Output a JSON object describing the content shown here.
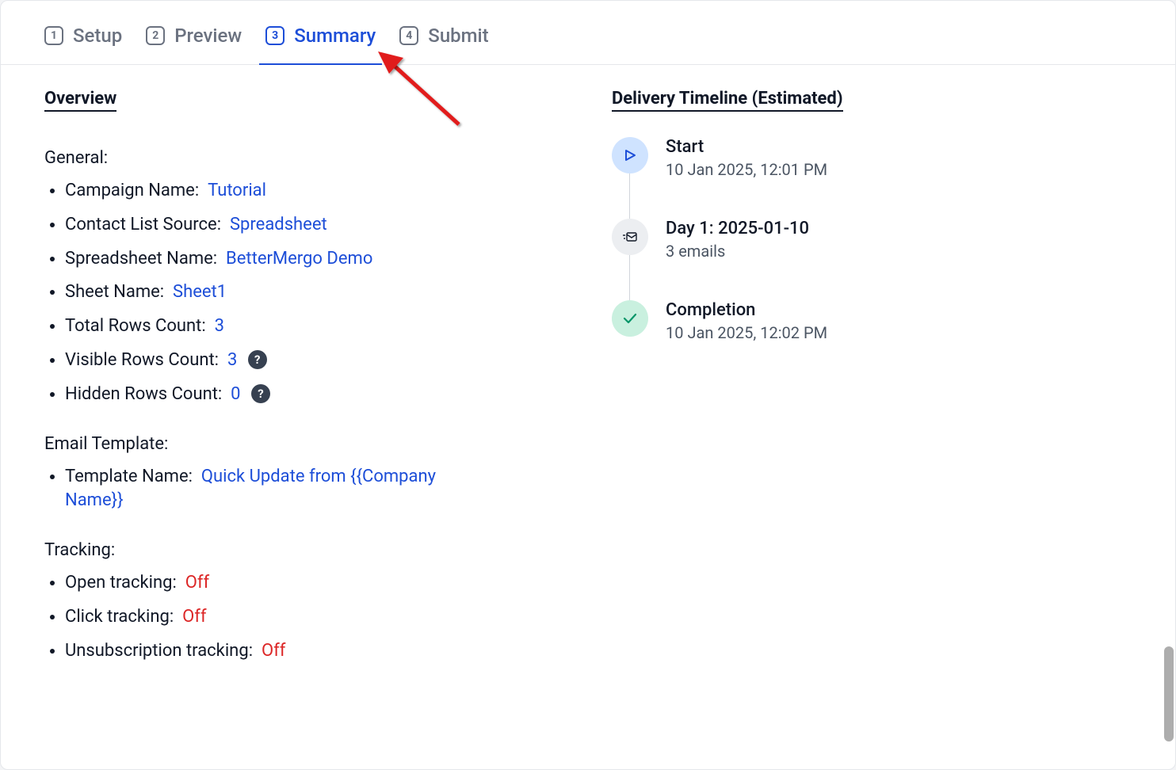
{
  "tabs": {
    "setup": {
      "num": "1",
      "label": "Setup"
    },
    "preview": {
      "num": "2",
      "label": "Preview"
    },
    "summary": {
      "num": "3",
      "label": "Summary"
    },
    "submit": {
      "num": "4",
      "label": "Submit"
    }
  },
  "overview": {
    "heading": "Overview",
    "general": {
      "heading": "General:",
      "items": {
        "campaign_name": {
          "label": "Campaign Name:",
          "value": "Tutorial"
        },
        "contact_source": {
          "label": "Contact List Source:",
          "value": "Spreadsheet"
        },
        "spreadsheet": {
          "label": "Spreadsheet Name:",
          "value": "BetterMergo Demo"
        },
        "sheet": {
          "label": "Sheet Name:",
          "value": "Sheet1"
        },
        "total_rows": {
          "label": "Total Rows Count:",
          "value": "3"
        },
        "visible_rows": {
          "label": "Visible Rows Count:",
          "value": "3"
        },
        "hidden_rows": {
          "label": "Hidden Rows Count:",
          "value": "0"
        }
      }
    },
    "template": {
      "heading": "Email Template:",
      "items": {
        "name": {
          "label": "Template Name:",
          "value": "Quick Update from {{Company Name}}"
        }
      }
    },
    "tracking": {
      "heading": "Tracking:",
      "items": {
        "open": {
          "label": "Open tracking:",
          "value": "Off"
        },
        "click": {
          "label": "Click tracking:",
          "value": "Off"
        },
        "unsub": {
          "label": "Unsubscription tracking:",
          "value": "Off"
        }
      }
    },
    "help_glyph": "?"
  },
  "timeline": {
    "heading": "Delivery Timeline (Estimated)",
    "start": {
      "title": "Start",
      "subtitle": "10 Jan 2025, 12:01 PM"
    },
    "day1": {
      "title": "Day 1: 2025-01-10",
      "subtitle": "3 emails"
    },
    "completion": {
      "title": "Completion",
      "subtitle": "10 Jan 2025, 12:02 PM"
    }
  }
}
